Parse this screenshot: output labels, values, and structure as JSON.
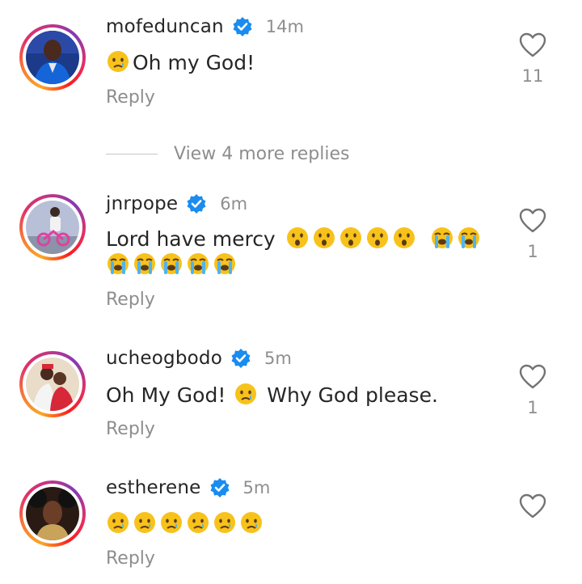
{
  "comments": [
    {
      "username": "mofeduncan",
      "time": "14m",
      "text": "Oh my God!",
      "reply_label": "Reply",
      "likes": "11",
      "emojis_before": [
        "crying-face"
      ]
    },
    {
      "username": "jnrpope",
      "time": "6m",
      "text": "Lord have mercy",
      "reply_label": "Reply",
      "likes": "1",
      "emojis_after": [
        "astonished-face",
        "astonished-face",
        "astonished-face",
        "astonished-face",
        "astonished-face",
        "loudly-crying-face",
        "loudly-crying-face"
      ],
      "emojis_line2": [
        "loudly-crying-face",
        "loudly-crying-face",
        "loudly-crying-face",
        "loudly-crying-face",
        "loudly-crying-face"
      ]
    },
    {
      "username": "ucheogbodo",
      "time": "5m",
      "text_part1": "Oh My God!",
      "text_part2": "Why God please.",
      "reply_label": "Reply",
      "likes": "1",
      "emojis_middle": [
        "crying-face"
      ]
    },
    {
      "username": "estherene",
      "time": "5m",
      "reply_label": "Reply",
      "emojis": [
        "crying-face",
        "crying-face",
        "crying-face",
        "crying-face",
        "crying-face",
        "crying-face"
      ]
    }
  ],
  "view_more": {
    "label": "View 4 more replies"
  },
  "colors": {
    "username": "#262626",
    "secondary": "#8e8e8e",
    "verified": "#1a8cf0",
    "emoji_face": "#f7c21b"
  }
}
